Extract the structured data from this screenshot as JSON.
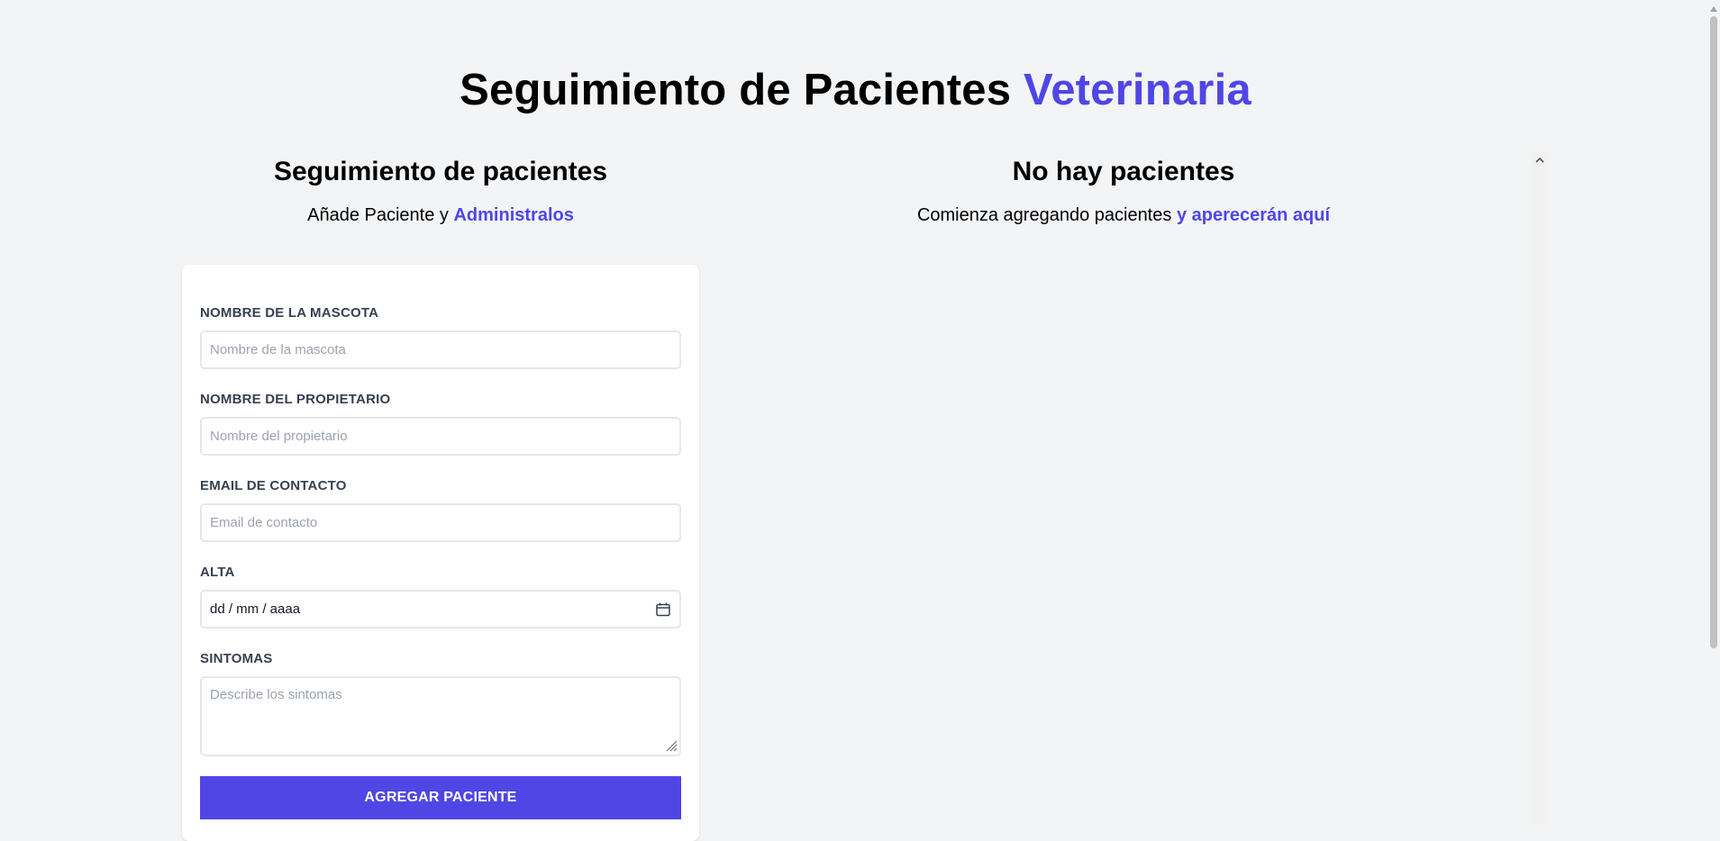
{
  "header": {
    "title_main": "Seguimiento de Pacientes",
    "title_accent": "Veterinaria"
  },
  "form_section": {
    "title": "Seguimiento de pacientes",
    "subtitle_plain": "Añade Paciente y",
    "subtitle_accent": "Administralos",
    "fields": {
      "pet_name": {
        "label": "NOMBRE DE LA MASCOTA",
        "placeholder": "Nombre de la mascota",
        "value": ""
      },
      "owner_name": {
        "label": "NOMBRE DEL PROPIETARIO",
        "placeholder": "Nombre del propietario",
        "value": ""
      },
      "email": {
        "label": "EMAIL DE CONTACTO",
        "placeholder": "Email de contacto",
        "value": ""
      },
      "discharge": {
        "label": "ALTA",
        "display": "dd / mm / aaaa",
        "icon": "calendar-icon"
      },
      "symptoms": {
        "label": "SINTOMAS",
        "placeholder": "Describe los sintomas",
        "value": ""
      }
    },
    "submit_label": "AGREGAR PACIENTE"
  },
  "list_section": {
    "title": "No hay pacientes",
    "subtitle_plain": "Comienza agregando pacientes",
    "subtitle_accent": "y aperecerán aquí"
  },
  "colors": {
    "accent": "#4f46e5",
    "background": "#f3f4f6",
    "card": "#ffffff",
    "label": "#374151",
    "placeholder": "#9ca3af"
  }
}
